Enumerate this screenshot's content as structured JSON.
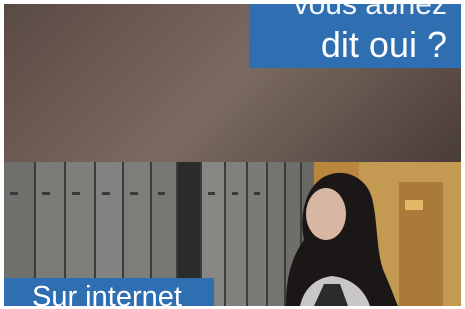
{
  "top_caption": {
    "line1": "vous auriez",
    "line2": "dit oui ?"
  },
  "bottom_caption": {
    "line": "Sur internet"
  },
  "colors": {
    "caption_blue": "#2f6fb1",
    "caption_text": "#ffffff"
  }
}
